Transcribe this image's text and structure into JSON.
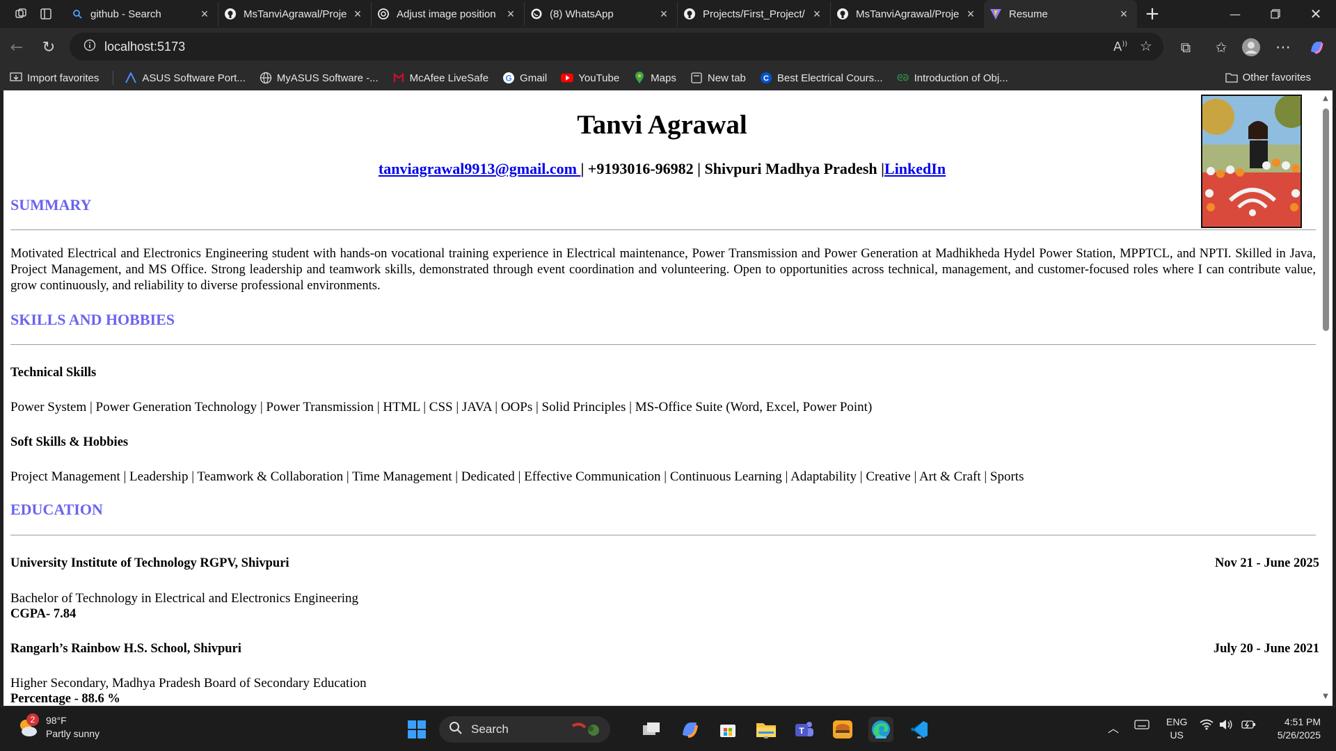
{
  "browser": {
    "tabs": [
      {
        "title": "github - Search",
        "icon": "search-icon"
      },
      {
        "title": "MsTanviAgrawal/Proje",
        "icon": "github-icon"
      },
      {
        "title": "Adjust image position",
        "icon": "openai-icon"
      },
      {
        "title": "(8) WhatsApp",
        "icon": "whatsapp-icon"
      },
      {
        "title": "Projects/First_Project/",
        "icon": "github-icon"
      },
      {
        "title": "MsTanviAgrawal/Proje",
        "icon": "github-icon"
      },
      {
        "title": "Resume",
        "icon": "vite-icon"
      }
    ],
    "url": "localhost:5173",
    "bookmarks": [
      {
        "label": "Import favorites",
        "icon": "import-icon"
      },
      {
        "label": "ASUS Software Port...",
        "icon": "asus-icon"
      },
      {
        "label": "MyASUS Software -...",
        "icon": "globe-icon"
      },
      {
        "label": "McAfee LiveSafe",
        "icon": "mcafee-icon"
      },
      {
        "label": "Gmail",
        "icon": "google-icon"
      },
      {
        "label": "YouTube",
        "icon": "youtube-icon"
      },
      {
        "label": "Maps",
        "icon": "maps-icon"
      },
      {
        "label": "New tab",
        "icon": "newtab-icon"
      },
      {
        "label": "Best Electrical Cours...",
        "icon": "coursera-icon"
      },
      {
        "label": "Introduction of Obj...",
        "icon": "gfg-icon"
      }
    ],
    "other_favorites": "Other favorites"
  },
  "resume": {
    "name": "Tanvi Agrawal",
    "email": "tanviagrawal9913@gmail.com ",
    "contact_rest": "| +9193016-96982 | Shivpuri Madhya Pradesh |",
    "linkedin": "LinkedIn",
    "summary_title": "SUMMARY",
    "summary_text": "Motivated Electrical and Electronics Engineering student with hands-on vocational training experience in Electrical maintenance, Power Transmission and Power Generation at Madhikheda Hydel Power Station, MPPTCL, and NPTI. Skilled in Java, Project Management, and MS Office. Strong leadership and teamwork skills, demonstrated through event coordination and volunteering. Open to opportunities across technical, management, and customer-focused roles where I can contribute value, grow continuously, and reliability to diverse professional environments.",
    "skills_title": "SKILLS AND HOBBIES",
    "tech_title": "Technical Skills",
    "tech_list": "Power System | Power Generation Technology | Power Transmission | HTML | CSS | JAVA | OOPs | Solid Principles | MS-Office Suite (Word, Excel, Power Point)",
    "soft_title": "Soft Skills & Hobbies",
    "soft_list": "Project Management | Leadership | Teamwork & Collaboration | Time Management | Dedicated | Effective Communication | Continuous Learning | Adaptability | Creative | Art & Craft | Sports",
    "education_title": "EDUCATION",
    "education": [
      {
        "institution": "University Institute of Technology RGPV, Shivpuri",
        "dates": "Nov 21 - June 2025",
        "degree": "Bachelor of Technology in Electrical and Electronics Engineering",
        "score": "CGPA- 7.84"
      },
      {
        "institution": "Rangarh’s Rainbow H.S. School, Shivpuri",
        "dates": "July 20 - June 2021",
        "degree": "Higher Secondary, Madhya Pradesh Board of Secondary Education",
        "score": "Percentage - 88.6 %"
      }
    ]
  },
  "taskbar": {
    "weather_temp": "98°F",
    "weather_desc": "Partly sunny",
    "weather_badge": "2",
    "search_label": "Search",
    "lang_top": "ENG",
    "lang_bottom": "US",
    "time": "4:51 PM",
    "date": "5/26/2025"
  }
}
